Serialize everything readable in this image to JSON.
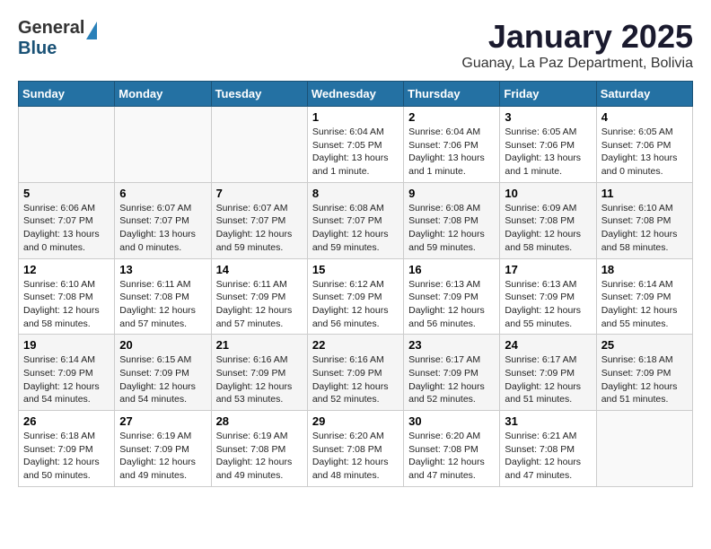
{
  "logo": {
    "general": "General",
    "blue": "Blue"
  },
  "title": "January 2025",
  "subtitle": "Guanay, La Paz Department, Bolivia",
  "days_of_week": [
    "Sunday",
    "Monday",
    "Tuesday",
    "Wednesday",
    "Thursday",
    "Friday",
    "Saturday"
  ],
  "weeks": [
    [
      {
        "day": "",
        "info": ""
      },
      {
        "day": "",
        "info": ""
      },
      {
        "day": "",
        "info": ""
      },
      {
        "day": "1",
        "info": "Sunrise: 6:04 AM\nSunset: 7:05 PM\nDaylight: 13 hours\nand 1 minute."
      },
      {
        "day": "2",
        "info": "Sunrise: 6:04 AM\nSunset: 7:06 PM\nDaylight: 13 hours\nand 1 minute."
      },
      {
        "day": "3",
        "info": "Sunrise: 6:05 AM\nSunset: 7:06 PM\nDaylight: 13 hours\nand 1 minute."
      },
      {
        "day": "4",
        "info": "Sunrise: 6:05 AM\nSunset: 7:06 PM\nDaylight: 13 hours\nand 0 minutes."
      }
    ],
    [
      {
        "day": "5",
        "info": "Sunrise: 6:06 AM\nSunset: 7:07 PM\nDaylight: 13 hours\nand 0 minutes."
      },
      {
        "day": "6",
        "info": "Sunrise: 6:07 AM\nSunset: 7:07 PM\nDaylight: 13 hours\nand 0 minutes."
      },
      {
        "day": "7",
        "info": "Sunrise: 6:07 AM\nSunset: 7:07 PM\nDaylight: 12 hours\nand 59 minutes."
      },
      {
        "day": "8",
        "info": "Sunrise: 6:08 AM\nSunset: 7:07 PM\nDaylight: 12 hours\nand 59 minutes."
      },
      {
        "day": "9",
        "info": "Sunrise: 6:08 AM\nSunset: 7:08 PM\nDaylight: 12 hours\nand 59 minutes."
      },
      {
        "day": "10",
        "info": "Sunrise: 6:09 AM\nSunset: 7:08 PM\nDaylight: 12 hours\nand 58 minutes."
      },
      {
        "day": "11",
        "info": "Sunrise: 6:10 AM\nSunset: 7:08 PM\nDaylight: 12 hours\nand 58 minutes."
      }
    ],
    [
      {
        "day": "12",
        "info": "Sunrise: 6:10 AM\nSunset: 7:08 PM\nDaylight: 12 hours\nand 58 minutes."
      },
      {
        "day": "13",
        "info": "Sunrise: 6:11 AM\nSunset: 7:08 PM\nDaylight: 12 hours\nand 57 minutes."
      },
      {
        "day": "14",
        "info": "Sunrise: 6:11 AM\nSunset: 7:09 PM\nDaylight: 12 hours\nand 57 minutes."
      },
      {
        "day": "15",
        "info": "Sunrise: 6:12 AM\nSunset: 7:09 PM\nDaylight: 12 hours\nand 56 minutes."
      },
      {
        "day": "16",
        "info": "Sunrise: 6:13 AM\nSunset: 7:09 PM\nDaylight: 12 hours\nand 56 minutes."
      },
      {
        "day": "17",
        "info": "Sunrise: 6:13 AM\nSunset: 7:09 PM\nDaylight: 12 hours\nand 55 minutes."
      },
      {
        "day": "18",
        "info": "Sunrise: 6:14 AM\nSunset: 7:09 PM\nDaylight: 12 hours\nand 55 minutes."
      }
    ],
    [
      {
        "day": "19",
        "info": "Sunrise: 6:14 AM\nSunset: 7:09 PM\nDaylight: 12 hours\nand 54 minutes."
      },
      {
        "day": "20",
        "info": "Sunrise: 6:15 AM\nSunset: 7:09 PM\nDaylight: 12 hours\nand 54 minutes."
      },
      {
        "day": "21",
        "info": "Sunrise: 6:16 AM\nSunset: 7:09 PM\nDaylight: 12 hours\nand 53 minutes."
      },
      {
        "day": "22",
        "info": "Sunrise: 6:16 AM\nSunset: 7:09 PM\nDaylight: 12 hours\nand 52 minutes."
      },
      {
        "day": "23",
        "info": "Sunrise: 6:17 AM\nSunset: 7:09 PM\nDaylight: 12 hours\nand 52 minutes."
      },
      {
        "day": "24",
        "info": "Sunrise: 6:17 AM\nSunset: 7:09 PM\nDaylight: 12 hours\nand 51 minutes."
      },
      {
        "day": "25",
        "info": "Sunrise: 6:18 AM\nSunset: 7:09 PM\nDaylight: 12 hours\nand 51 minutes."
      }
    ],
    [
      {
        "day": "26",
        "info": "Sunrise: 6:18 AM\nSunset: 7:09 PM\nDaylight: 12 hours\nand 50 minutes."
      },
      {
        "day": "27",
        "info": "Sunrise: 6:19 AM\nSunset: 7:09 PM\nDaylight: 12 hours\nand 49 minutes."
      },
      {
        "day": "28",
        "info": "Sunrise: 6:19 AM\nSunset: 7:08 PM\nDaylight: 12 hours\nand 49 minutes."
      },
      {
        "day": "29",
        "info": "Sunrise: 6:20 AM\nSunset: 7:08 PM\nDaylight: 12 hours\nand 48 minutes."
      },
      {
        "day": "30",
        "info": "Sunrise: 6:20 AM\nSunset: 7:08 PM\nDaylight: 12 hours\nand 47 minutes."
      },
      {
        "day": "31",
        "info": "Sunrise: 6:21 AM\nSunset: 7:08 PM\nDaylight: 12 hours\nand 47 minutes."
      },
      {
        "day": "",
        "info": ""
      }
    ]
  ]
}
